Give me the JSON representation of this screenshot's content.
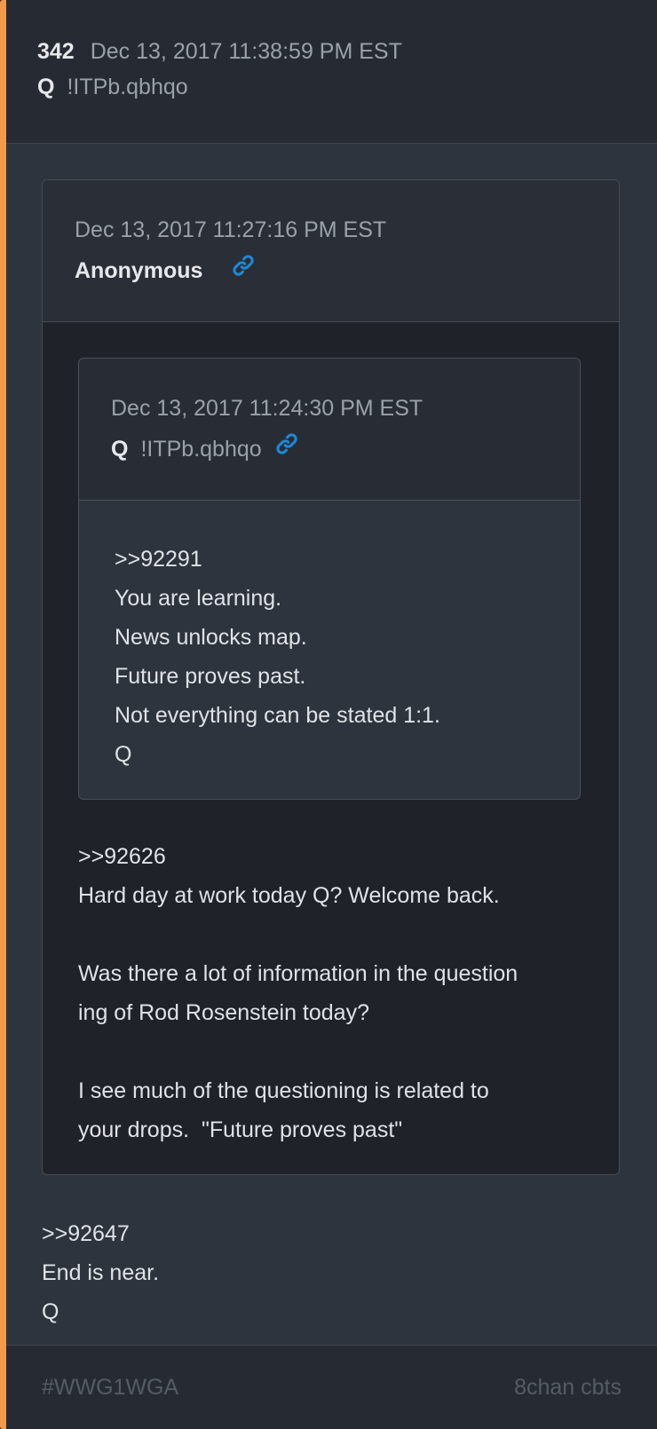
{
  "post": {
    "number": "342",
    "date": "Dec 13, 2017 11:38:59 PM EST",
    "name": "Q",
    "tripcode": "!ITPb.qbhqo"
  },
  "ref": {
    "date": "Dec 13, 2017 11:27:16 PM EST",
    "name": "Anonymous",
    "link_icon": "link-icon",
    "nested_ref": {
      "date": "Dec 13, 2017 11:24:30 PM EST",
      "name": "Q",
      "tripcode": "!ITPb.qbhqo",
      "link_icon": "link-icon",
      "lines": [
        ">>92291",
        "You are learning.",
        "News unlocks map.",
        "Future proves past.",
        "Not everything can be stated 1:1.",
        "Q"
      ]
    },
    "lines": [
      ">>92626",
      "Hard day at work today Q? Welcome back.",
      "",
      "Was there a lot of information in the question",
      "ing of Rod Rosenstein today?",
      "",
      "I see much of the questioning is related to",
      "your drops.  \"Future proves past\""
    ]
  },
  "body_lines": [
    ">>92647",
    "End is near.",
    "Q"
  ],
  "footer": {
    "hashtag": "#WWG1WGA",
    "source": "8chan cbts"
  },
  "colors": {
    "accent": "#f2994a",
    "link": "#1e88d6"
  }
}
